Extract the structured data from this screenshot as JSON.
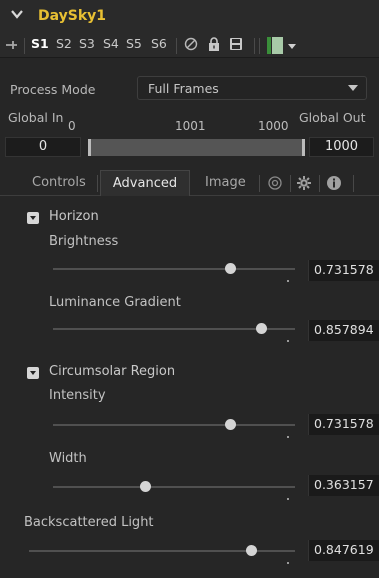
{
  "tool": {
    "name": "DaySky1"
  },
  "toolbar": {
    "slots": [
      "S1",
      "S2",
      "S3",
      "S4",
      "S5",
      "S6"
    ],
    "active_slot": "S1"
  },
  "process": {
    "label": "Process Mode",
    "value": "Full Frames"
  },
  "range": {
    "in_label": "Global In",
    "out_label": "Global Out",
    "start_num": "0",
    "mid_num": "1001",
    "end_num": "1000",
    "in_value": "0",
    "out_value": "1000"
  },
  "tabs": [
    "Controls",
    "Advanced",
    "Image"
  ],
  "active_tab": "Advanced",
  "sections": {
    "horizon": {
      "title": "Horizon",
      "brightness": {
        "label": "Brightness",
        "value": "0.731578"
      },
      "gradient": {
        "label": "Luminance Gradient",
        "value": "0.857894"
      }
    },
    "circumsolar": {
      "title": "Circumsolar Region",
      "intensity": {
        "label": "Intensity",
        "value": "0.731578"
      },
      "width": {
        "label": "Width",
        "value": "0.363157"
      }
    },
    "backscattered": {
      "label": "Backscattered Light",
      "value": "0.847619"
    }
  },
  "colors": {
    "title": "#e8c033",
    "chip": "#a8caa8"
  }
}
